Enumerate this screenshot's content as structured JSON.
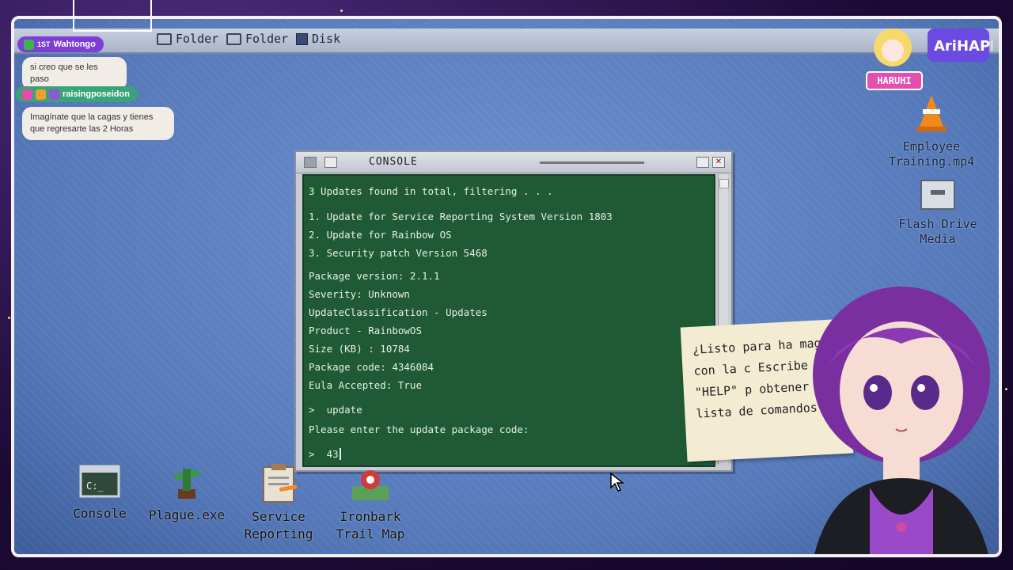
{
  "topbar": {
    "items": [
      {
        "label": "Folder",
        "icon": "folder-icon"
      },
      {
        "label": "Folder",
        "icon": "folder-icon"
      },
      {
        "label": "Disk",
        "icon": "disk-icon"
      }
    ]
  },
  "chat": {
    "messages": [
      {
        "user": "Wahtongo",
        "rank": "1ST",
        "text": "si creo que se les paso",
        "color": "#7b3fd4"
      },
      {
        "user": "raisingposeidon",
        "text": "Imagínate que la cagas y tienes que regresarte las 2 Horas",
        "color": "#3aa37a"
      }
    ]
  },
  "console": {
    "title": "CONSOLE",
    "lines": [
      "3 Updates found in total, filtering . . .",
      "1. Update for Service Reporting System Version 1803",
      "2. Update for Rainbow OS",
      "3. Security patch Version 5468",
      "Package version: 2.1.1",
      "Severity: Unknown",
      "UpdateClassification - Updates",
      "Product - RainbowOS",
      "Size (KB) : 10784",
      "Package code: 4346084",
      "Eula Accepted: True",
      ">  update",
      "Please enter the update package code:",
      ">  43"
    ]
  },
  "desktop_icons": [
    {
      "label": "Console",
      "icon": "console-icon"
    },
    {
      "label": "Plague.exe",
      "icon": "plant-icon"
    },
    {
      "label": "Service Reporting",
      "icon": "clipboard-icon"
    },
    {
      "label": "Ironbark Trail Map",
      "icon": "map-icon"
    }
  ],
  "right_icons": [
    {
      "label": "Employee Training.mp4",
      "icon": "traffic-cone-icon"
    },
    {
      "label": "Flash Drive Media",
      "icon": "flash-drive-icon"
    }
  ],
  "note": {
    "text": "¿Listo para ha magia con la c Escribe \"HELP\" p obtener la lista de comandos."
  },
  "branding": {
    "name_tag": "HARUHI",
    "logo": "AriHAPPS"
  },
  "colors": {
    "console_bg": "#1f5a35",
    "desktop_bg": "#5e82c0",
    "frame": "#f4f0f6"
  }
}
